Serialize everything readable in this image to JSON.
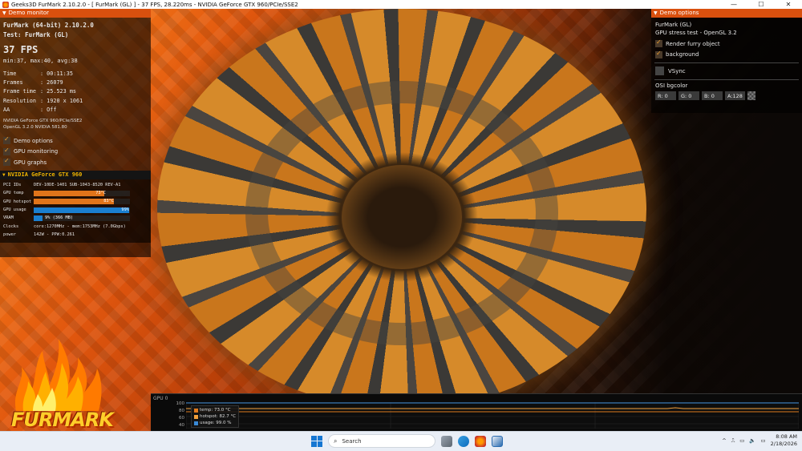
{
  "window": {
    "title": "Geeks3D FurMark 2.10.2.0 - [ FurMark (GL) ] - 37 FPS, 28.220ms - NVIDIA GeForce GTX 960/PCIe/SSE2",
    "minimize_glyph": "—",
    "maximize_glyph": "☐",
    "close_glyph": "✕"
  },
  "demo_monitor": {
    "header": "Demo monitor",
    "app_line": "FurMark (64-bit) 2.10.2.0",
    "test_line": "Test: FurMark (GL)",
    "fps": "37 FPS",
    "minmax": "min:37, max:40, avg:38",
    "stats": [
      {
        "key": "Time",
        "value": ": 00:11:35"
      },
      {
        "key": "Frames",
        "value": ": 26079"
      },
      {
        "key": "Frame time",
        "value": ": 25.523 ms"
      },
      {
        "key": "Resolution",
        "value": ": 1920 x 1061"
      },
      {
        "key": "AA",
        "value": ": Off"
      }
    ],
    "renderer": "NVIDIA GeForce GTX 960/PCIe/SSE2",
    "opengl": "OpenGL 3.2.0 NVIDIA 581.80",
    "checks": [
      {
        "label": "Demo options",
        "checked": true
      },
      {
        "label": "GPU monitoring",
        "checked": true
      },
      {
        "label": "GPU graphs",
        "checked": true
      }
    ]
  },
  "gpu_panel": {
    "header": "NVIDIA GeForce GTX 960",
    "pci_label": "PCI IDs",
    "pci_value": "DEV-10DE-1401 SUB-1043-8520 REV-A1",
    "temp_label": "GPU temp",
    "temp_value": "73°C",
    "temp_fraction": 0.73,
    "hotspot_label": "GPU hotspot",
    "hotspot_value": "83°C",
    "hotspot_fraction": 0.83,
    "usage_label": "GPU usage",
    "usage_value": "99%",
    "usage_fraction": 0.99,
    "vram_label": "VRAM",
    "vram_value": "9% (366 MB)",
    "vram_fraction": 0.09,
    "clocks_label": "Clocks",
    "clocks_value": "core:1270MHz - mem:1753MHz (7.0Gbps)",
    "power_label": "power",
    "power_value": "142W - PPW:0.261"
  },
  "logo": {
    "word": "FURMARK"
  },
  "demo_options": {
    "header": "Demo options",
    "title": "FurMark (GL)",
    "subtitle": "GPU stress test - OpenGL 3.2",
    "checks": [
      {
        "label": "Render furry object",
        "checked": true
      },
      {
        "label": "background",
        "checked": true
      }
    ],
    "vsync": {
      "label": "VSync",
      "checked": false
    },
    "osi_label": "OSI bgcolor",
    "channels": [
      "R: 0",
      "G: 0",
      "B: 0",
      "A:128"
    ]
  },
  "gpu_graph": {
    "title": "GPU 0",
    "yticks": [
      "100",
      "80",
      "60",
      "40"
    ],
    "legend": [
      {
        "label": "temp: 73.0 °C",
        "color": "#e07a1e"
      },
      {
        "label": "hotspot: 82.7 °C",
        "color": "#f2a03c"
      },
      {
        "label": "usage: 99.0 %",
        "color": "#3a8ad6"
      }
    ]
  },
  "taskbar": {
    "search_placeholder": "Search",
    "time": "8:08 AM",
    "date": "2/18/2026",
    "tray_chevron": "^"
  },
  "colors": {
    "accent_orange": "#d9500e",
    "nvidia_yellow": "#f0b400",
    "usage_blue": "#1a7fd0"
  }
}
